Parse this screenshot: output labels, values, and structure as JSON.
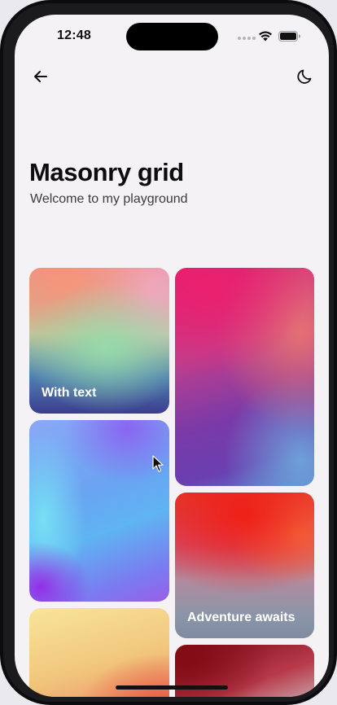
{
  "status_bar": {
    "time": "12:48",
    "icons": [
      "signal-dots-icon",
      "wifi-icon",
      "battery-icon"
    ]
  },
  "nav": {
    "back_icon": "arrow-left-icon",
    "theme_icon": "moon-icon"
  },
  "header": {
    "title": "Masonry grid",
    "subtitle": "Welcome to my playground"
  },
  "grid": {
    "cards": [
      {
        "label": "With text"
      },
      {
        "label": ""
      },
      {
        "label": ""
      },
      {
        "label": "Adventure awaits"
      },
      {
        "label": ""
      },
      {
        "label": ""
      }
    ]
  },
  "colors": {
    "background": "#f4f2f4",
    "text_primary": "#0d0d0f",
    "text_secondary": "#3b3b40"
  }
}
